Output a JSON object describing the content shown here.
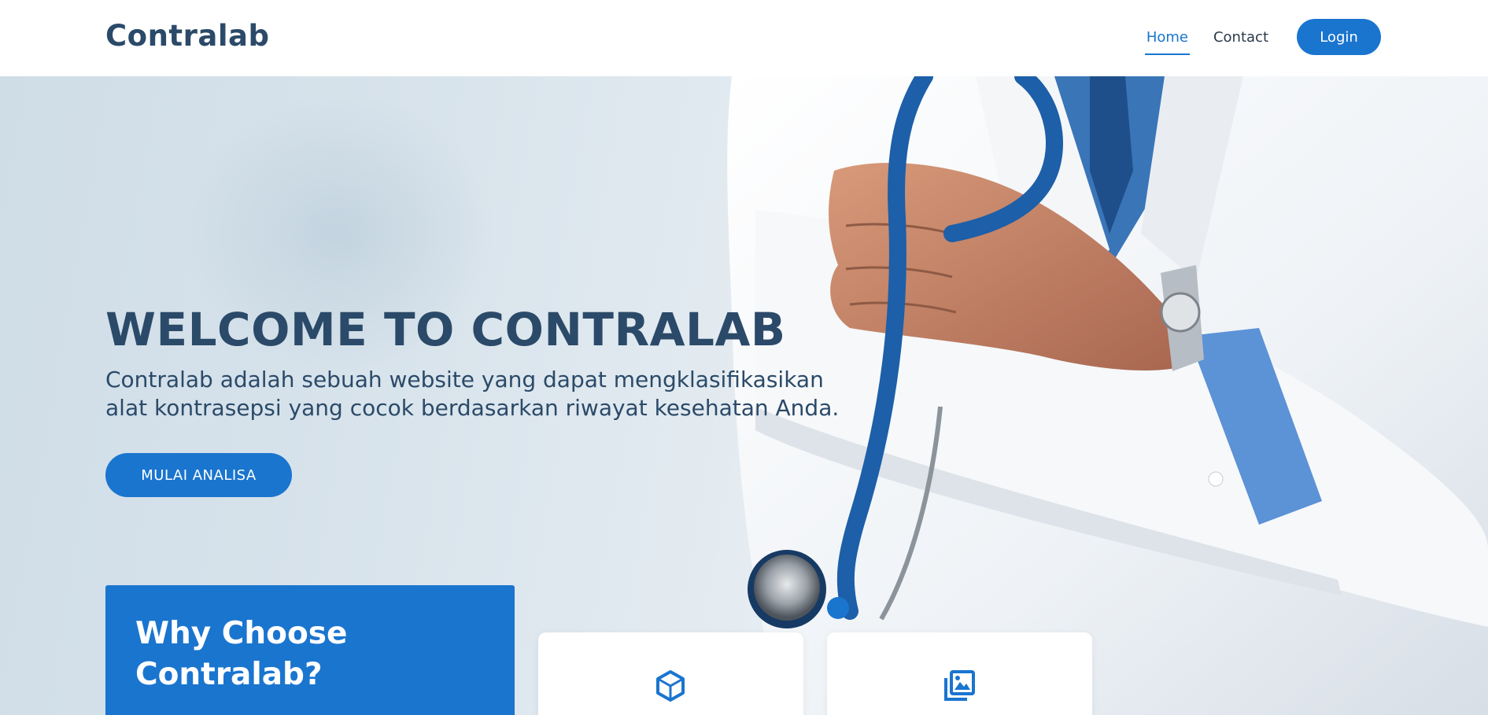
{
  "header": {
    "logo": "Contralab",
    "nav": {
      "home": "Home",
      "contact": "Contact",
      "login": "Login"
    }
  },
  "hero": {
    "title": "WELCOME TO CONTRALAB",
    "description": "Contralab adalah sebuah website yang dapat mengklasifikasikan alat kontrasepsi yang cocok berdasarkan riwayat kesehatan Anda.",
    "cta_label": "MULAI ANALISA"
  },
  "why": {
    "title": "Why Choose Contralab?"
  },
  "features": [
    {
      "icon": "cube-icon"
    },
    {
      "icon": "images-icon"
    }
  ],
  "colors": {
    "brand_blue": "#1a75cf",
    "heading_navy": "#2b4a69"
  }
}
